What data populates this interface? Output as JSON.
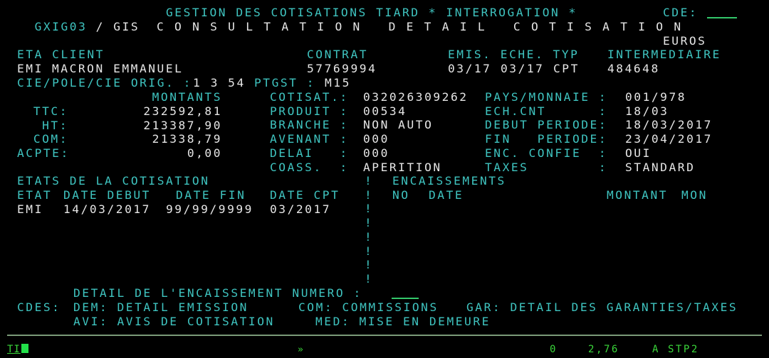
{
  "header": {
    "program": "GXIG03",
    "separator": "/",
    "system": "GIS",
    "title": "GESTION DES COTISATIONS TIARD * INTERROGATION *",
    "cde_label": "CDE:",
    "cde_value": "",
    "subtitle": "CONSULTATION DETAIL COTISATION",
    "currency": "EUROS"
  },
  "client": {
    "labels": {
      "eta_client": "ETA CLIENT",
      "contrat": "CONTRAT",
      "emis_eche_typ": "EMIS. ECHE. TYP",
      "intermediaire": "INTERMEDIAIRE"
    },
    "values": {
      "eta": "EMI",
      "client": "MACRON EMMANUEL",
      "contrat": "57769994",
      "emis": "03/17",
      "eche": "03/17",
      "typ": "CPT",
      "intermediaire": "484648"
    },
    "cie_label": "CIE/POLE/CIE ORIG. :",
    "cie_value": "1 3 54",
    "ptgst_label": "PTGST :",
    "ptgst_value": "M15"
  },
  "montants": {
    "header": "MONTANTS",
    "rows": [
      {
        "label": "TTC:",
        "value": "232592,81"
      },
      {
        "label": "HT:",
        "value": "213387,90"
      },
      {
        "label": "COM:",
        "value": "21338,79"
      },
      {
        "label": "ACPTE:",
        "value": "0,00"
      }
    ]
  },
  "details_mid": [
    {
      "label": "COTISAT.:",
      "value": "032026309262"
    },
    {
      "label": "PRODUIT :",
      "value": "00534"
    },
    {
      "label": "BRANCHE :",
      "value": "NON AUTO"
    },
    {
      "label": "AVENANT :",
      "value": "000"
    },
    {
      "label": "DELAI   :",
      "value": "000"
    },
    {
      "label": "COASS.  :",
      "value": "APERITION"
    }
  ],
  "details_right": [
    {
      "label": "PAYS/MONNAIE :",
      "value": "001/978"
    },
    {
      "label": "ECH.CNT      :",
      "value": "18/03"
    },
    {
      "label": "DEBUT PERIODE:",
      "value": "18/03/2017"
    },
    {
      "label": "FIN   PERIODE:",
      "value": "23/04/2017"
    },
    {
      "label": "ENC. CONFIE  :",
      "value": "OUI"
    },
    {
      "label": "TAXES        :",
      "value": "STANDARD"
    }
  ],
  "etats": {
    "title": "ETATS DE LA COTISATION",
    "columns": [
      "ETAT",
      "DATE DEBUT",
      "DATE FIN",
      "DATE CPT"
    ],
    "rows": [
      {
        "etat": "EMI",
        "date_debut": "14/03/2017",
        "date_fin": "99/99/9999",
        "date_cpt": "03/2017"
      }
    ]
  },
  "encaissements": {
    "title": "ENCAISSEMENTS",
    "columns": [
      "NO",
      "DATE",
      "MONTANT",
      "MON"
    ],
    "rows": []
  },
  "divider_char": "!",
  "detail_prompt": {
    "label": "DETAIL DE L'ENCAISSEMENT NUMERO :",
    "value": ""
  },
  "commands": {
    "label": "CDES:",
    "items": [
      {
        "code": "DEM:",
        "desc": "DETAIL EMISSION"
      },
      {
        "code": "COM:",
        "desc": "COMMISSIONS"
      },
      {
        "code": "GAR:",
        "desc": "DETAIL DES GARANTIES/TAXES"
      },
      {
        "code": "AVI:",
        "desc": "AVIS DE COTISATION"
      },
      {
        "code": "MED:",
        "desc": "MISE EN DEMEURE"
      }
    ]
  },
  "status_bar": {
    "indicator": "TI",
    "arrow": "»",
    "field1": "0",
    "field2": "2,76",
    "field3": "A STP2"
  },
  "colors": {
    "protected": "#3fc4c0",
    "data": "#e6e6e6",
    "status": "#3ad63a",
    "background": "#000000"
  }
}
